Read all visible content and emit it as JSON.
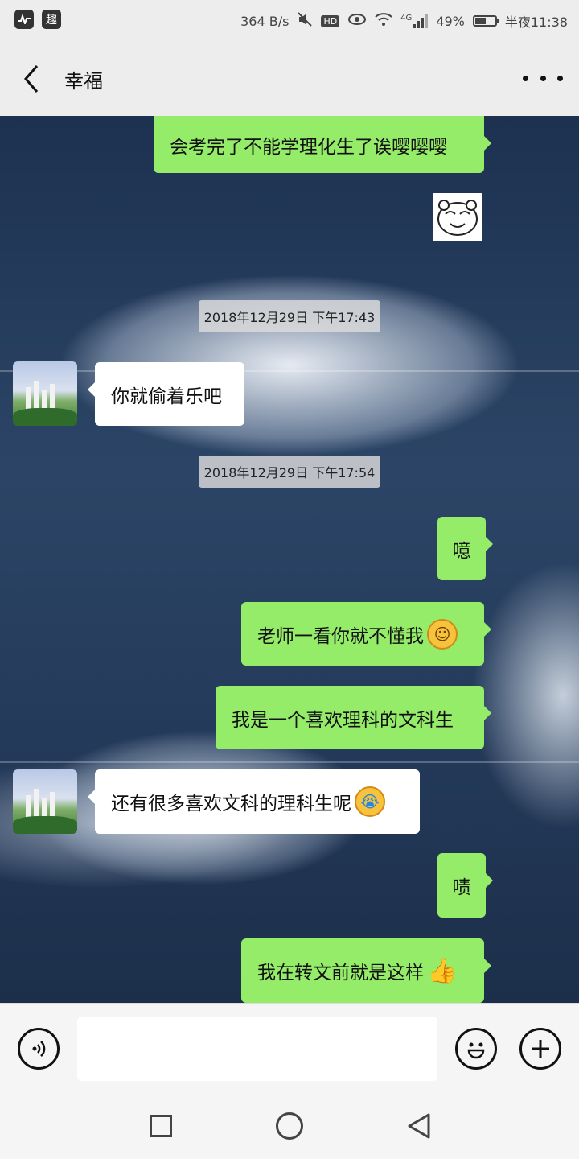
{
  "status_bar": {
    "net_speed": "364 B/s",
    "hd": "HD",
    "signal": "4G",
    "battery": "49%",
    "time": "半夜11:38",
    "app_icon": "趣"
  },
  "header": {
    "title": "幸福"
  },
  "messages": {
    "m1": "会考完了不能学理化生了诶嘤嘤嘤",
    "ts1": "2018年12月29日 下午17:43",
    "m2": "你就偷着乐吧",
    "ts2": "2018年12月29日 下午17:54",
    "m3": "噫",
    "m4": "老师一看你就不懂我",
    "m5": "我是一个喜欢理科的文科生",
    "m6": "还有很多喜欢文科的理科生呢",
    "m7": "啧",
    "m8": "我在转文前就是这样"
  },
  "emoji": {
    "smile": "☺",
    "cry": "😭",
    "thumb": "👍"
  },
  "input": {
    "value": ""
  },
  "battery_level": 0.49
}
